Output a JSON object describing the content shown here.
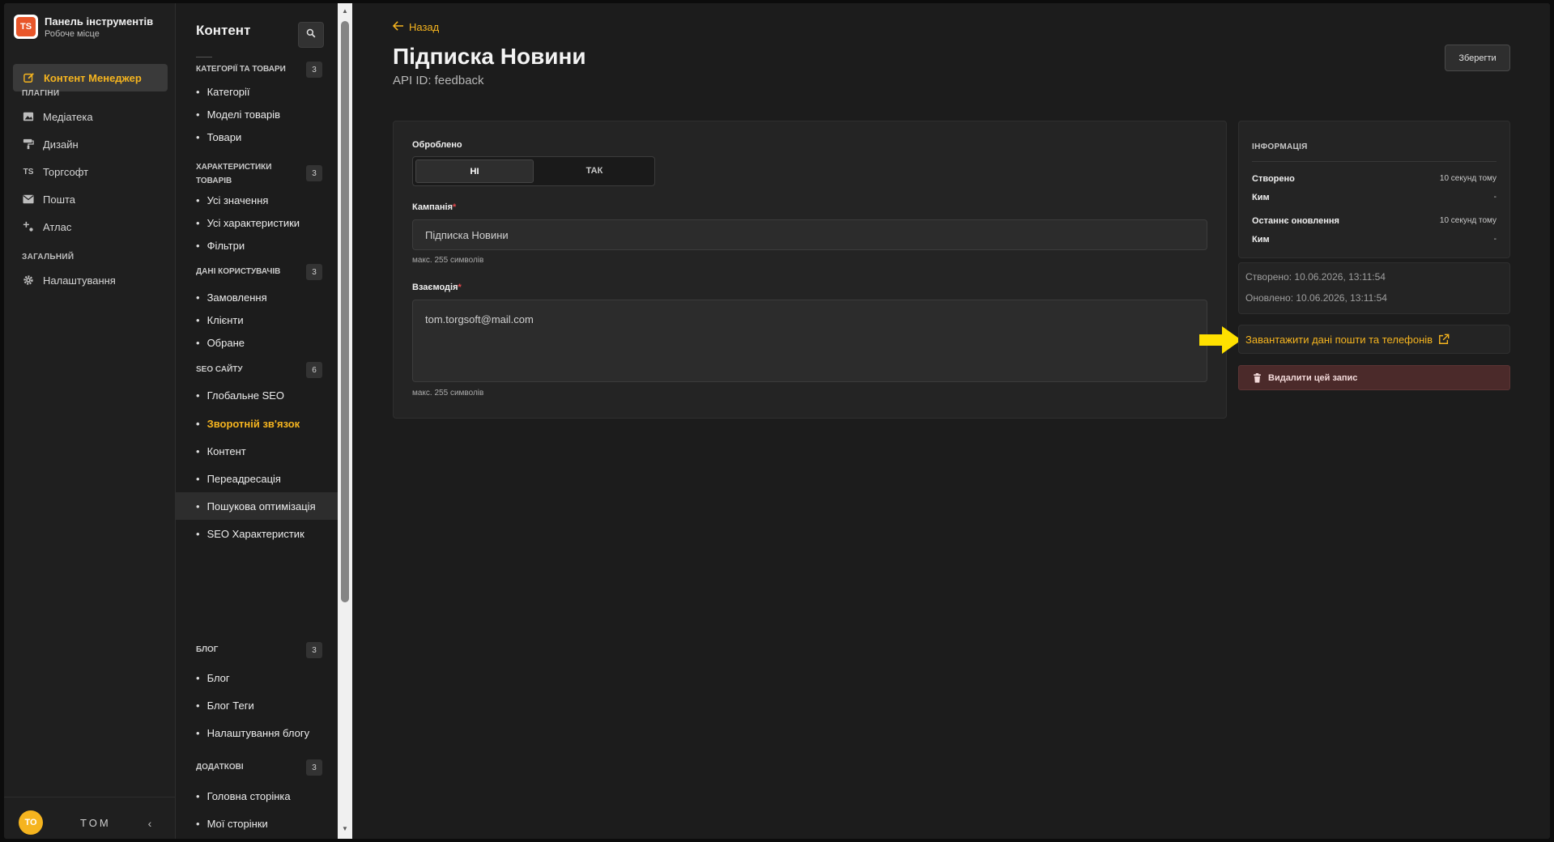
{
  "brand": {
    "logo_text": "TS",
    "title": "Панель інструментів",
    "subtitle": "Робоче місце"
  },
  "nav": {
    "active_item": "Контент Менеджер",
    "sections": [
      {
        "title": "ПЛАГІНИ",
        "items": [
          "Медіатека",
          "Дизайн",
          "Торгсофт",
          "Пошта",
          "Атлас"
        ]
      },
      {
        "title": "ЗАГАЛЬНИЙ",
        "items": [
          "Налаштування"
        ]
      }
    ]
  },
  "user": {
    "initials": "TO",
    "name": "TOM"
  },
  "content_panel": {
    "title": "Контент",
    "groups": [
      {
        "title": "КАТЕГОРІЇ ТА ТОВАРИ",
        "count": "3",
        "items": [
          "Категорії",
          "Моделі товарів",
          "Товари"
        ]
      },
      {
        "title": "ХАРАКТЕРИСТИКИ ТОВАРІВ",
        "count": "3",
        "items": [
          "Усі значення",
          "Усі характеристики",
          "Фільтри"
        ]
      },
      {
        "title": "ДАНІ КОРИСТУВАЧІВ",
        "count": "3",
        "items": [
          "Замовлення",
          "Клієнти",
          "Обране"
        ]
      },
      {
        "title": "SEO САЙТУ",
        "count": "6",
        "items": [
          "Глобальне SEO",
          "Зворотній зв'язок",
          "Контент",
          "Переадресація",
          "Пошукова оптимізація",
          "SEO Характеристик"
        ]
      },
      {
        "title": "БЛОГ",
        "count": "3",
        "items": [
          "Блог",
          "Блог Теги",
          "Налаштування блогу"
        ]
      },
      {
        "title": "ДОДАТКОВІ",
        "count": "3",
        "items": [
          "Головна сторінка",
          "Мої сторінки"
        ]
      }
    ],
    "active_item": "Зворотній зв'язок"
  },
  "main": {
    "back_label": "Назад",
    "title": "Підписка Новини",
    "api_id": "API ID: feedback",
    "save_label": "Зберегти",
    "form": {
      "processed_label": "Оброблено",
      "toggle_no": "НІ",
      "toggle_yes": "ТАК",
      "toggle_selected": "НІ",
      "campaign_label": "Кампанія",
      "campaign_value": "Підписка Новини",
      "campaign_hint": "макс. 255 символів",
      "interaction_label": "Взаємодія",
      "interaction_value": "tom.torgsoft@mail.com",
      "interaction_hint": "макс. 255 символів",
      "required_mark": "*"
    }
  },
  "info": {
    "title": "ІНФОРМАЦІЯ",
    "created_label": "Створено",
    "created_value": "10 секунд тому",
    "created_by_label": "Ким",
    "created_by_value": "-",
    "updated_label": "Останнє оновлення",
    "updated_value": "10 секунд тому",
    "updated_by_label": "Ким",
    "updated_by_value": "-",
    "created_at": "Створено: 10.06.2026, 13:11:54",
    "updated_at": "Оновлено: 10.06.2026, 13:11:54",
    "download_label": "Завантажити дані пошти та телефонів",
    "delete_label": "Видалити цей запис"
  },
  "colors": {
    "accent": "#f5b41f",
    "background": "#1c1c1c",
    "danger_bg": "#4b2a2a",
    "marker": "#ffe000"
  }
}
